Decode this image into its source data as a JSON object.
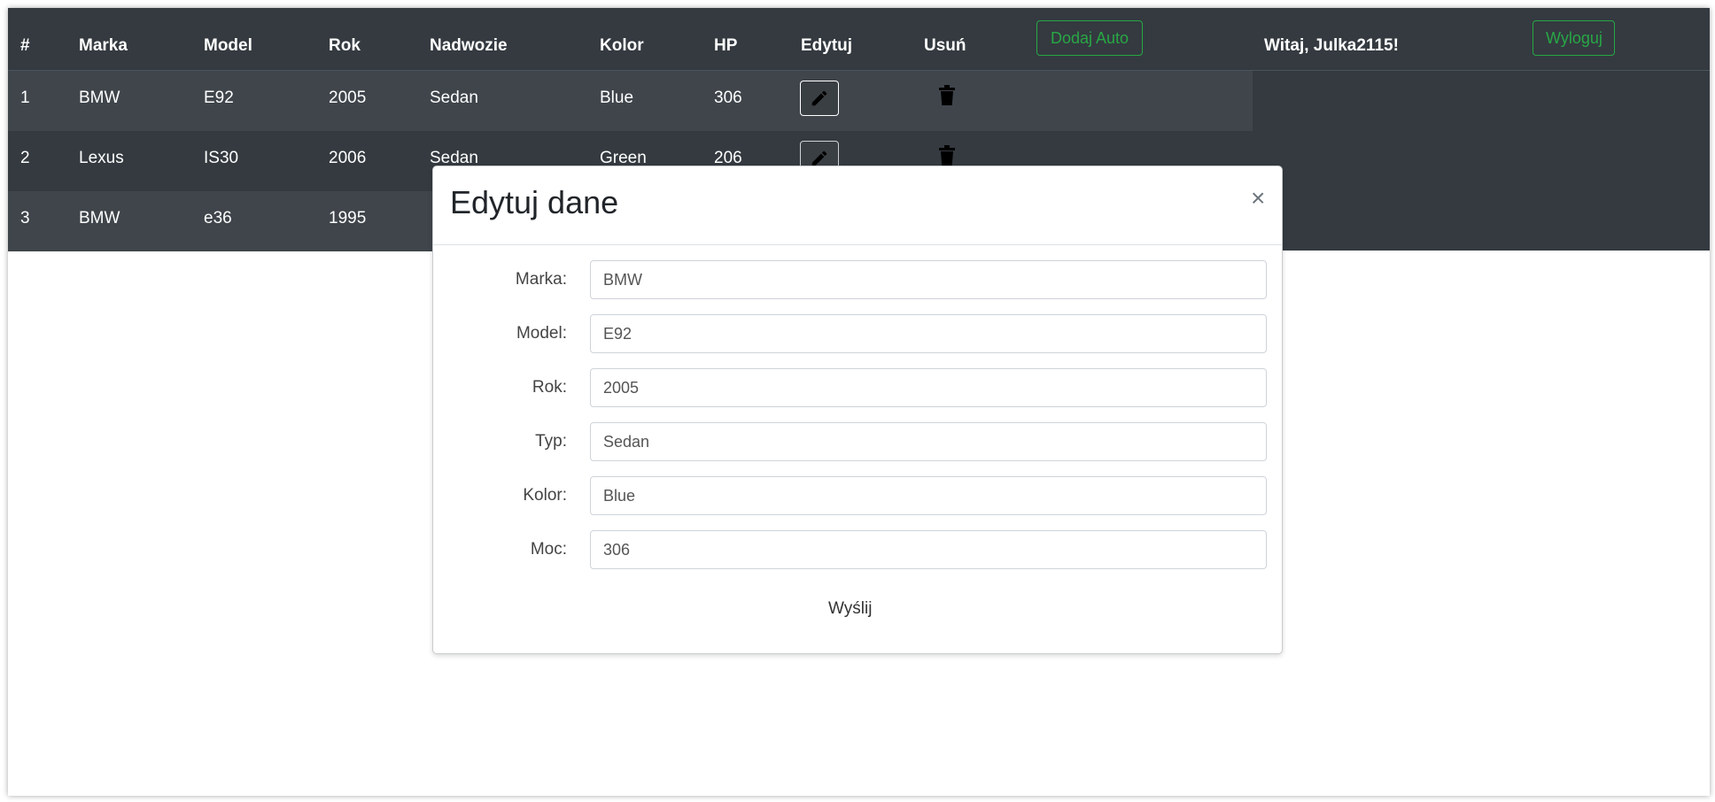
{
  "table": {
    "headers": [
      "#",
      "Marka",
      "Model",
      "Rok",
      "Nadwozie",
      "Kolor",
      "HP",
      "Edytuj",
      "Usuń"
    ],
    "rows": [
      {
        "num": "1",
        "marka": "BMW",
        "model": "E92",
        "rok": "2005",
        "nadwozie": "Sedan",
        "kolor": "Blue",
        "hp": "306"
      },
      {
        "num": "2",
        "marka": "Lexus",
        "model": "IS30",
        "rok": "2006",
        "nadwozie": "Sedan",
        "kolor": "Green",
        "hp": "206"
      },
      {
        "num": "3",
        "marka": "BMW",
        "model": "e36",
        "rok": "1995",
        "nadwozie": "",
        "kolor": "",
        "hp": ""
      }
    ]
  },
  "header": {
    "add_label": "Dodaj Auto",
    "welcome": "Witaj, Julka2115!",
    "logout_label": "Wyloguj"
  },
  "modal": {
    "title": "Edytuj dane",
    "close": "×",
    "fields": [
      {
        "label": "Marka:",
        "value": "BMW"
      },
      {
        "label": "Model:",
        "value": "E92"
      },
      {
        "label": "Rok:",
        "value": "2005"
      },
      {
        "label": "Typ:",
        "value": "Sedan"
      },
      {
        "label": "Kolor:",
        "value": "Blue"
      },
      {
        "label": "Moc:",
        "value": "306"
      }
    ],
    "submit_label": "Wyślij"
  },
  "colors": {
    "table_bg": "#343a40",
    "accent_green": "#28a745"
  }
}
